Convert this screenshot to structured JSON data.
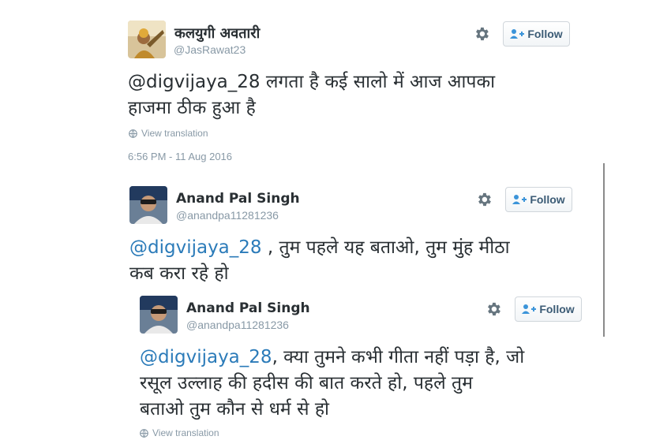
{
  "tweets": [
    {
      "name": "कलयुगी अवतारी",
      "handle": "@JasRawat23",
      "follow_label": "Follow",
      "mention": "@digvijaya_28",
      "text_line1": " लगता है कई सालो में आज आपका",
      "text_line2": "हाजमा ठीक हुआ है",
      "view_translation": "View translation",
      "timestamp": "6:56 PM - 11 Aug 2016"
    },
    {
      "name": "Anand Pal Singh",
      "handle": "@anandpa11281236",
      "follow_label": "Follow",
      "mention": "@digvijaya_28",
      "text_line1": " , तुम पहले यह बताओ, तुम मुंह मीठा",
      "text_line2": "कब करा रहे हो"
    },
    {
      "name": "Anand Pal Singh",
      "handle": "@anandpa11281236",
      "follow_label": "Follow",
      "mention": "@digvijaya_28",
      "text_line1": ", क्या तुमने कभी गीता नहीं पड़ा है, जो",
      "text_line2": "रसूल उल्लाह की हदीस की बात करते हो, पहले तुम",
      "text_line3": "बताओ तुम कौन से धर्म से हो",
      "view_translation": "View translation"
    }
  ],
  "icons": {
    "settings": "gear-icon",
    "follow": "add-user-icon",
    "translation": "globe-icon"
  },
  "colors": {
    "mention_link": "#2b7bb9",
    "text": "#292f33",
    "meta": "#8899a6",
    "follow_text": "#3b5b75"
  }
}
